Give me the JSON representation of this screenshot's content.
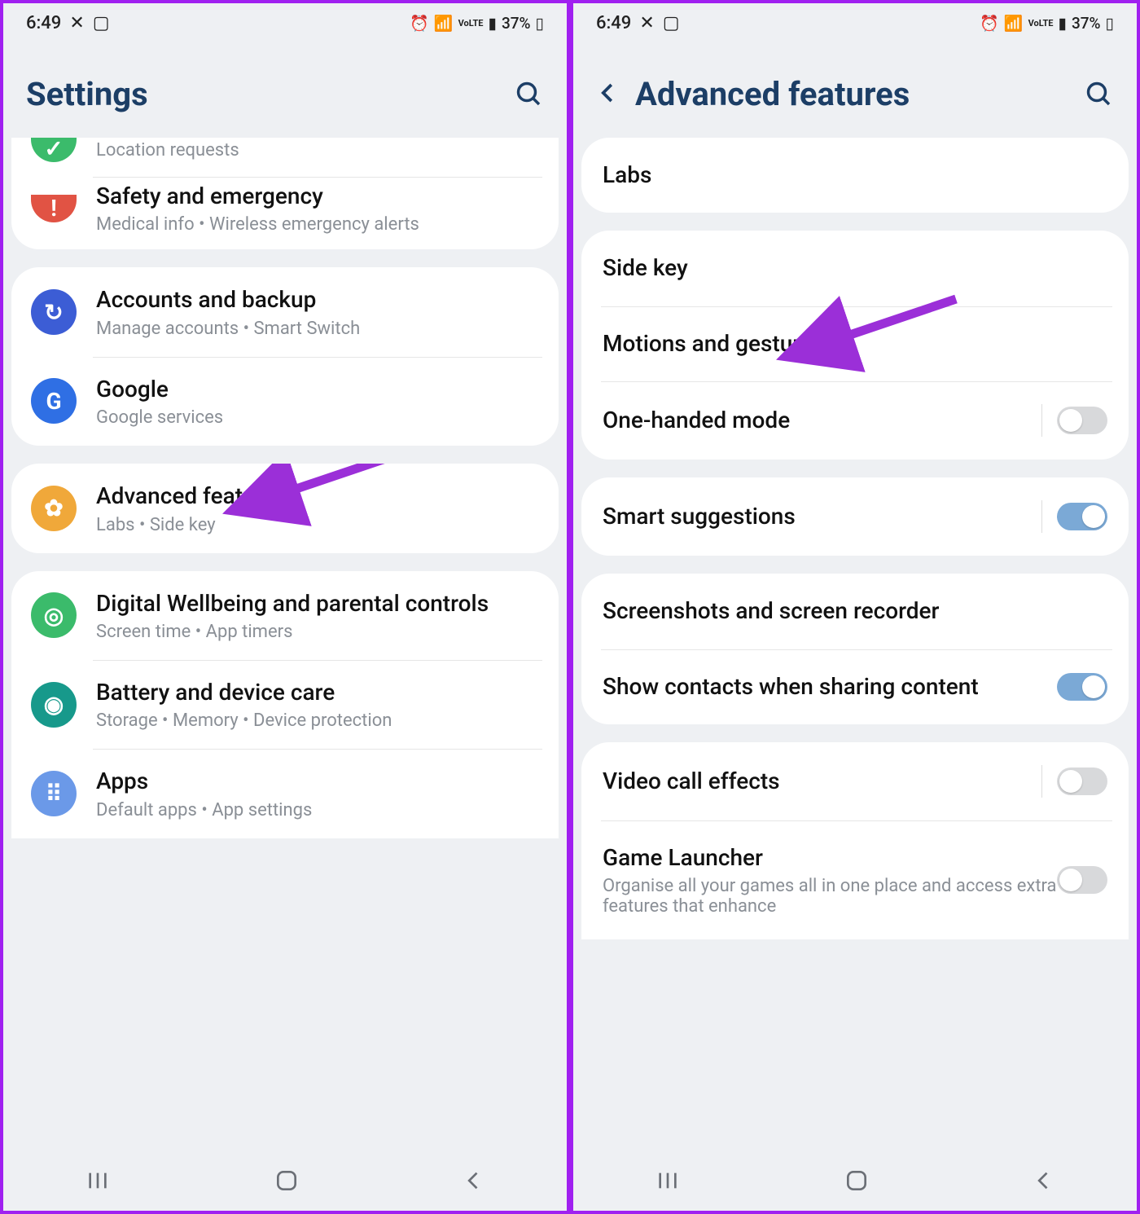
{
  "status": {
    "time": "6:49",
    "battery": "37%"
  },
  "left": {
    "title": "Settings",
    "groups": [
      {
        "firstCut": true,
        "rows": [
          {
            "icon_bg": "#3bbb6b",
            "icon_glyph": "✓",
            "title": "",
            "sub": "Location requests",
            "partial": true
          },
          {
            "icon_bg": "#e15344",
            "icon_glyph": "!",
            "title": "Safety and emergency",
            "sub": "Medical info  •  Wireless emergency alerts"
          }
        ]
      },
      {
        "rows": [
          {
            "icon_bg": "#3c5dd5",
            "icon_glyph": "↻",
            "title": "Accounts and backup",
            "sub": "Manage accounts  •  Smart Switch"
          },
          {
            "icon_bg": "#2f6fe4",
            "icon_glyph": "G",
            "title": "Google",
            "sub": "Google services"
          }
        ]
      },
      {
        "rows": [
          {
            "icon_bg": "#f0a83a",
            "icon_glyph": "✿",
            "title": "Advanced features",
            "sub": "Labs  •  Side key",
            "arrow": true
          }
        ]
      },
      {
        "lastCut": true,
        "rows": [
          {
            "icon_bg": "#3bbb6b",
            "icon_glyph": "◎",
            "title": "Digital Wellbeing and parental controls",
            "sub": "Screen time  •  App timers"
          },
          {
            "icon_bg": "#17998b",
            "icon_glyph": "◉",
            "title": "Battery and device care",
            "sub": "Storage  •  Memory  •  Device protection"
          },
          {
            "icon_bg": "#6b99e8",
            "icon_glyph": "⠿",
            "title": "Apps",
            "sub": "Default apps  •  App settings"
          }
        ]
      }
    ]
  },
  "right": {
    "title": "Advanced features",
    "groups": [
      {
        "rows": [
          {
            "title": "Labs"
          }
        ]
      },
      {
        "rows": [
          {
            "title": "Side key"
          },
          {
            "title": "Motions and gestures",
            "arrow": true
          },
          {
            "title": "One-handed mode",
            "toggle": "off",
            "sep": true
          }
        ]
      },
      {
        "rows": [
          {
            "title": "Smart suggestions",
            "toggle": "on",
            "sep": true
          }
        ]
      },
      {
        "rows": [
          {
            "title": "Screenshots and screen recorder"
          },
          {
            "title": "Show contacts when sharing content",
            "toggle": "on"
          }
        ]
      },
      {
        "lastCut": true,
        "rows": [
          {
            "title": "Video call effects",
            "toggle": "off",
            "sep": true
          },
          {
            "title": "Game Launcher",
            "sub": "Organise all your games all in one place and access extra features that enhance",
            "toggle": "off"
          }
        ]
      }
    ]
  }
}
